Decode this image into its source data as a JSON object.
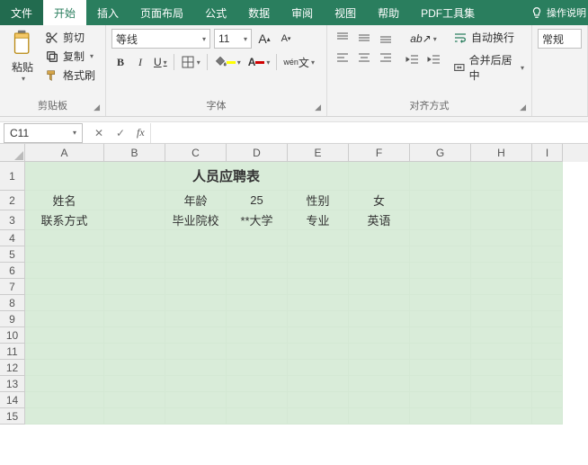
{
  "menu": {
    "file": "文件",
    "home": "开始",
    "insert": "插入",
    "layout": "页面布局",
    "formula": "公式",
    "data": "数据",
    "review": "审阅",
    "view": "视图",
    "help": "帮助",
    "pdf": "PDF工具集",
    "tip": "操作说明"
  },
  "ribbon": {
    "paste": "粘贴",
    "cut": "剪切",
    "copy": "复制",
    "format_painter": "格式刷",
    "clipboard": "剪贴板",
    "font_name": "等线",
    "font_size": "11",
    "grow": "A",
    "shrink": "A",
    "wen": "wén",
    "bold": "B",
    "italic": "I",
    "underline": "U",
    "font_group": "字体",
    "wrap": "自动换行",
    "merge": "合并后居中",
    "align_group": "对齐方式",
    "general": "常规"
  },
  "nb": {
    "ref": "C11"
  },
  "cols": [
    "A",
    "B",
    "C",
    "D",
    "E",
    "F",
    "G",
    "H",
    "I"
  ],
  "cells": {
    "title": "人员应聘表",
    "A2": "姓名",
    "C2": "年龄",
    "D2": "25",
    "E2": "性别",
    "F2": "女",
    "A3": "联系方式",
    "C3": "毕业院校",
    "D3": "**大学",
    "E3": "专业",
    "F3": "英语"
  }
}
